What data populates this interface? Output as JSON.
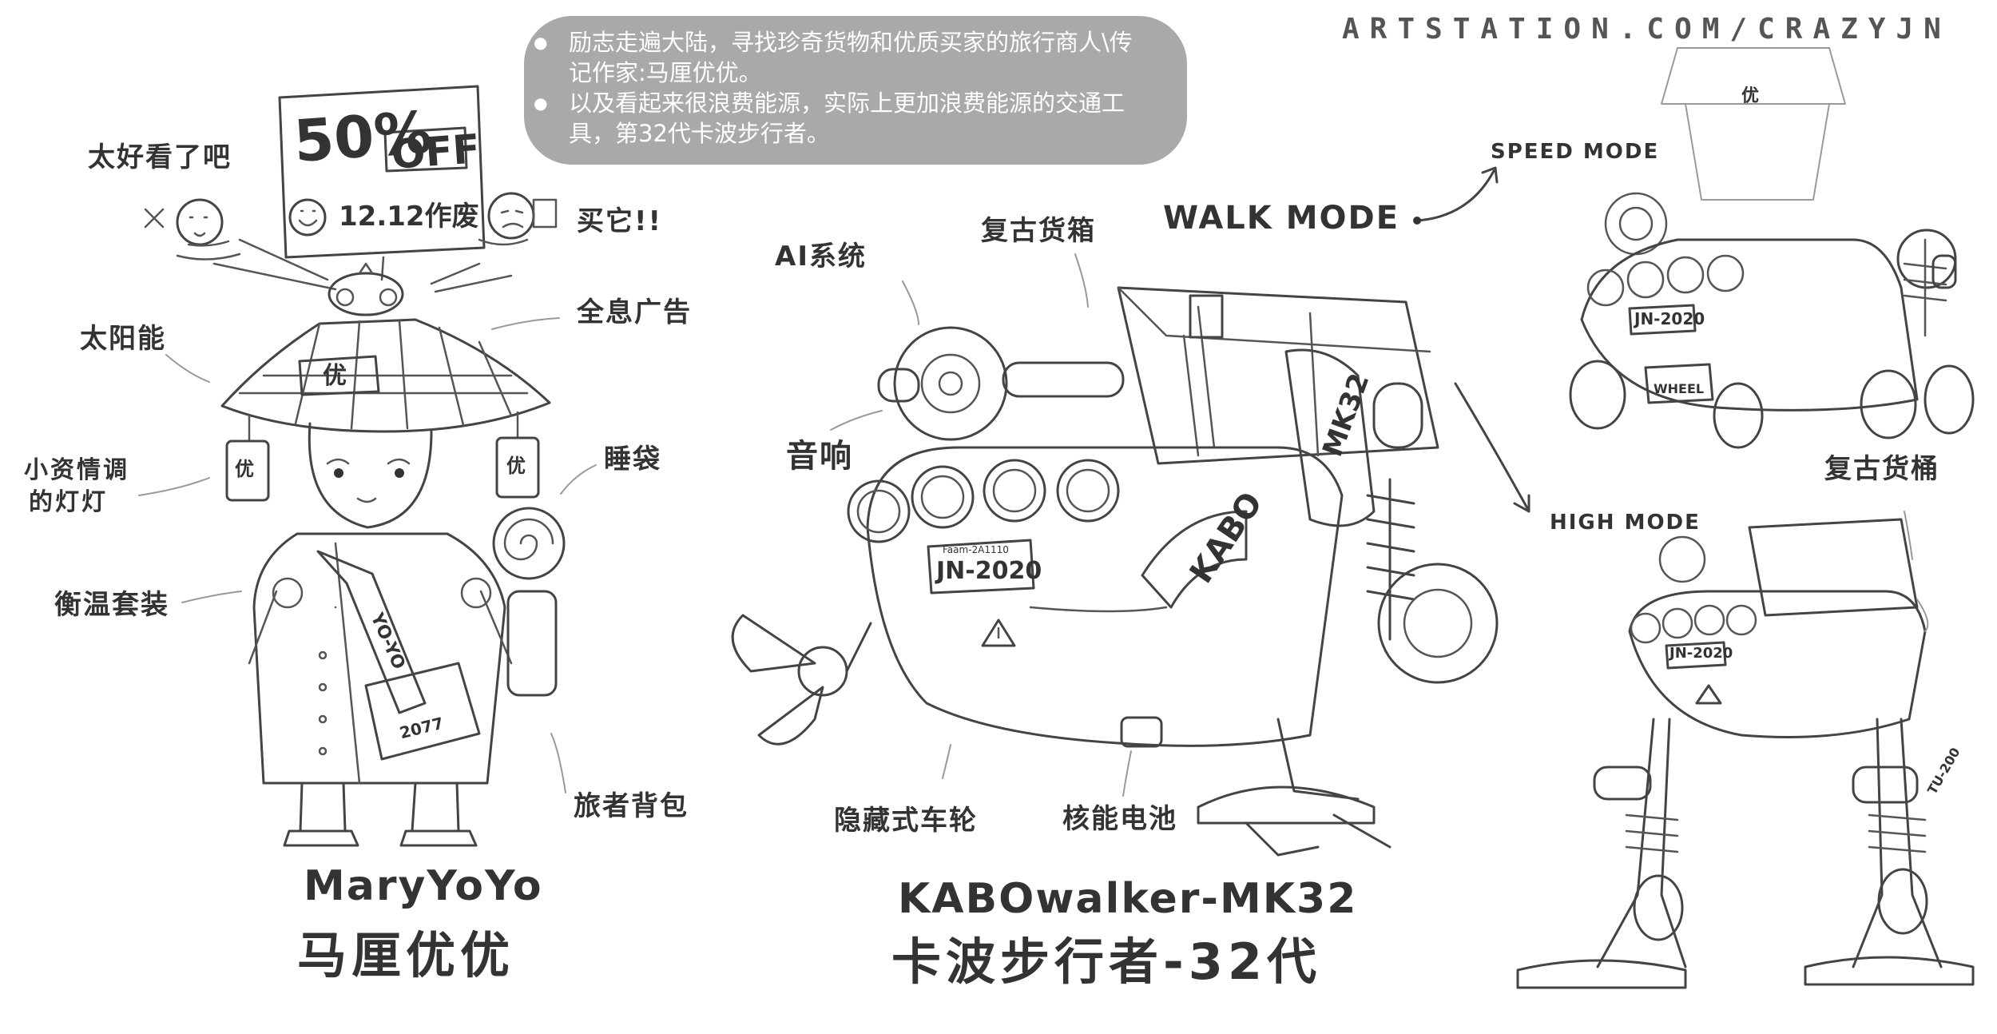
{
  "watermark": "ARTSTATION.COM/CRAZYJN",
  "note": {
    "line1": "励志走遍大陆，寻找珍奇货物和优质买家的旅行商人\\传记作家:马厘优优。",
    "line2": "以及看起来很浪费能源，实际上更加浪费能源的交通工具，第32代卡波步行者。"
  },
  "character": {
    "sign_discount": "50%",
    "sign_off": "OFF",
    "sign_date": "12.12作废",
    "hat_badge": "优",
    "lantern_badge": "优",
    "strap_text": "YO-YO",
    "bag_text": "2077",
    "labels": {
      "too_good": "太好看了吧",
      "buy_it": "买它!!",
      "solar": "太阳能",
      "hologram_ad": "全息广告",
      "mood_lamp_line1": "小资情调",
      "mood_lamp_line2": "的灯灯",
      "sleeping_bag": "睡袋",
      "thermal_suit": "衡温套装",
      "backpack": "旅者背包"
    },
    "name_en": "MaryYoYo",
    "name_cn": "马厘优优"
  },
  "walker": {
    "labels": {
      "ai_system": "AI系统",
      "retro_box": "复古货箱",
      "walk_mode": "WALK MODE",
      "speaker": "音响",
      "hidden_wheels": "隐藏式车轮",
      "nuclear_battery": "核能电池"
    },
    "hull_text": "KABO",
    "side_text": "MK32",
    "plate_small": "Faam-2A1110",
    "plate": "JN-2020",
    "name_en": "KABOwalker-MK32",
    "name_cn": "卡波步行者-32代"
  },
  "modes": {
    "speed_mode": "SPEED MODE",
    "high_mode": "HIGH MODE",
    "retro_bucket": "复古货桶",
    "speed_plate": "JN-2020",
    "speed_badge": "优",
    "wheel_text": "WHEEL",
    "high_plate": "JN-2020",
    "side_tag": "TU-200"
  }
}
